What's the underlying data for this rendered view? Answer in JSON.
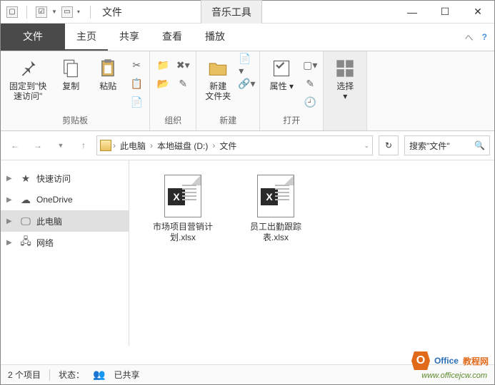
{
  "titlebar": {
    "title": "文件",
    "context_tab": "音乐工具"
  },
  "tabs": {
    "file": "文件",
    "home": "主页",
    "share": "共享",
    "view": "查看",
    "play": "播放"
  },
  "ribbon": {
    "pin": "固定到\"快\n速访问\"",
    "copy": "复制",
    "paste": "粘贴",
    "clipboard_group": "剪贴板",
    "organize_group": "组织",
    "newfolder": "新建\n文件夹",
    "new_group": "新建",
    "properties": "属性",
    "open_group": "打开",
    "select": "选择"
  },
  "breadcrumb": {
    "seg1": "此电脑",
    "seg2": "本地磁盘 (D:)",
    "seg3": "文件"
  },
  "search": {
    "placeholder": "搜索\"文件\""
  },
  "nav": {
    "quick": "快速访问",
    "onedrive": "OneDrive",
    "thispc": "此电脑",
    "network": "网络"
  },
  "files": [
    {
      "name": "市场项目营销计划.xlsx",
      "badge": "X"
    },
    {
      "name": "员工出勤跟踪表.xlsx",
      "badge": "X"
    }
  ],
  "status": {
    "count": "2 个项目",
    "state_label": "状态：",
    "state": "已共享"
  },
  "watermark": {
    "brand1": "Office",
    "brand2": "教程网",
    "url": "www.officejcw.com"
  }
}
